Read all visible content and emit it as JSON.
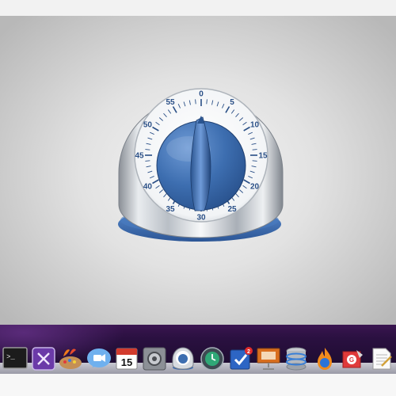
{
  "dial": {
    "numbers": [
      "0",
      "5",
      "10",
      "15",
      "20",
      "25",
      "30",
      "35",
      "40",
      "45",
      "50",
      "55"
    ],
    "set_minutes": 0
  },
  "colors": {
    "knob_blue": "#3d6eb0",
    "dial_text": "#2a4f86",
    "base_blue": "#3a6ab0"
  },
  "dock": {
    "calendar_day": "15",
    "tasks_badge": "2",
    "items": [
      {
        "icon": "terminal-icon"
      },
      {
        "icon": "script-editor-icon"
      },
      {
        "icon": "paint-palette-icon"
      },
      {
        "icon": "video-chat-icon"
      },
      {
        "icon": "calendar-icon"
      },
      {
        "icon": "system-preferences-icon"
      },
      {
        "icon": "timer-icon"
      },
      {
        "icon": "time-machine-icon"
      },
      {
        "icon": "task-checklist-icon"
      },
      {
        "icon": "presentation-icon"
      },
      {
        "icon": "database-icon"
      },
      {
        "icon": "fire-app-icon"
      },
      {
        "icon": "mail-stamp-icon"
      },
      {
        "icon": "text-document-icon"
      }
    ]
  }
}
